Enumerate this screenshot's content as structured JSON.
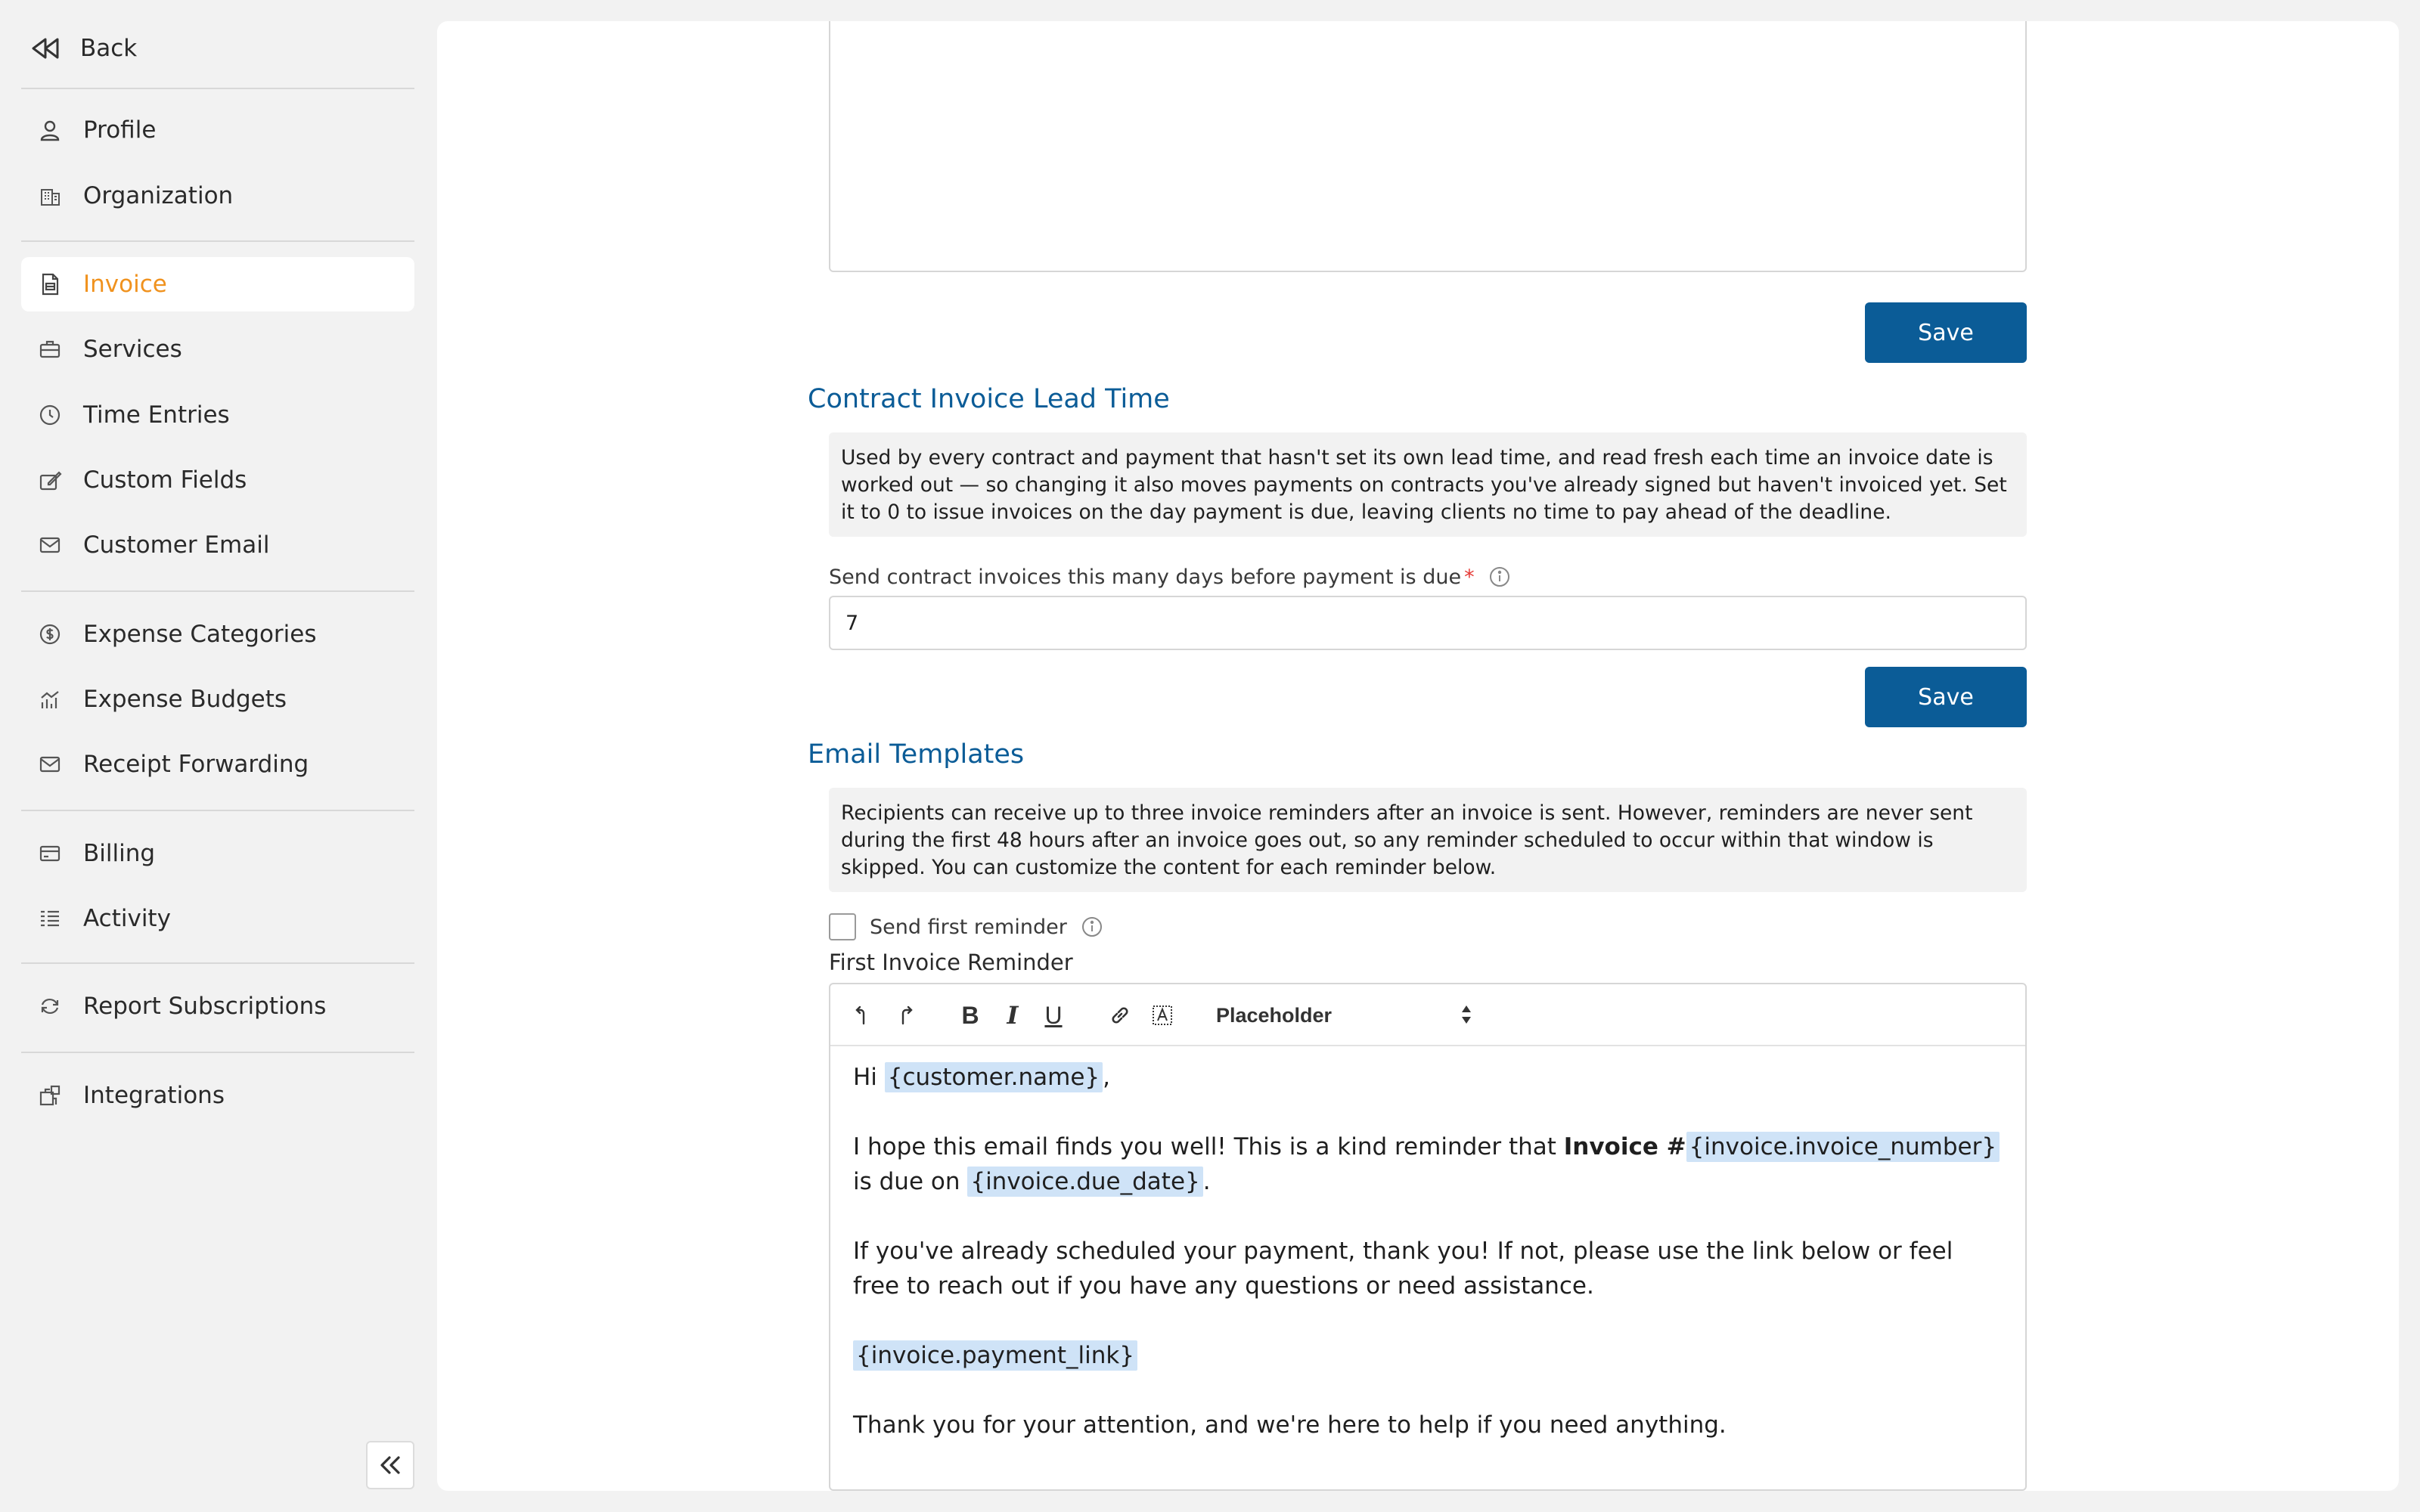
{
  "sidebar": {
    "back_label": "Back",
    "items": [
      {
        "label": "Profile",
        "icon": "user-icon"
      },
      {
        "label": "Organization",
        "icon": "building-icon"
      },
      {
        "label": "Invoice",
        "icon": "invoice-icon",
        "active": true
      },
      {
        "label": "Services",
        "icon": "briefcase-icon"
      },
      {
        "label": "Time Entries",
        "icon": "clock-icon"
      },
      {
        "label": "Custom Fields",
        "icon": "edit-field-icon"
      },
      {
        "label": "Customer Email",
        "icon": "mail-icon"
      },
      {
        "label": "Expense Categories",
        "icon": "dollar-circle-icon"
      },
      {
        "label": "Expense Budgets",
        "icon": "bar-chart-icon"
      },
      {
        "label": "Receipt Forwarding",
        "icon": "mail-icon"
      },
      {
        "label": "Billing",
        "icon": "card-icon"
      },
      {
        "label": "Activity",
        "icon": "list-icon"
      },
      {
        "label": "Report Subscriptions",
        "icon": "refresh-icon"
      },
      {
        "label": "Integrations",
        "icon": "puzzle-icon"
      }
    ]
  },
  "accent_color": "#f0921e",
  "primary_color": "#0b5c97",
  "main": {
    "save_label": "Save",
    "lead_time": {
      "title": "Contract Invoice Lead Time",
      "note": "Used by every contract and payment that hasn't set its own lead time, and read fresh each time an invoice date is worked out — so changing it also moves payments on contracts you've already signed but haven't invoiced yet. Set it to 0 to issue invoices on the day payment is due, leaving clients no time to pay ahead of the deadline.",
      "field_label": "Send contract invoices this many days before payment is due",
      "field_required_mark": "*",
      "field_value": "7"
    },
    "email_templates": {
      "title": "Email Templates",
      "note": "Recipients can receive up to three invoice reminders after an invoice is sent. However, reminders are never sent during the first 48 hours after an invoice goes out, so any reminder scheduled to occur within that window is skipped. You can customize the content for each reminder below.",
      "checkbox_label": "Send first reminder",
      "checkbox_checked": false,
      "editor_label": "First Invoice Reminder",
      "toolbar": {
        "bold": "B",
        "italic": "I",
        "underline": "U",
        "placeholder_select": "Placeholder"
      },
      "body": {
        "greeting": "Hi ",
        "token_customer_name": "{customer.name}",
        "greeting_end": ",",
        "p2_a": "I hope this email finds you well! This is a kind reminder that ",
        "p2_bold": "Invoice #",
        "token_invoice_number": "{invoice.invoice_number}",
        "p2_b": " is due on ",
        "token_due_date": "{invoice.due_date}",
        "p2_end": ".",
        "p3": "If you've already scheduled your payment, thank you! If not, please use the link below or feel free to reach out if you have any questions or need assistance.",
        "token_payment_link": "{invoice.payment_link}",
        "p5": "Thank you for your attention, and we're here to help if you need anything."
      }
    }
  }
}
